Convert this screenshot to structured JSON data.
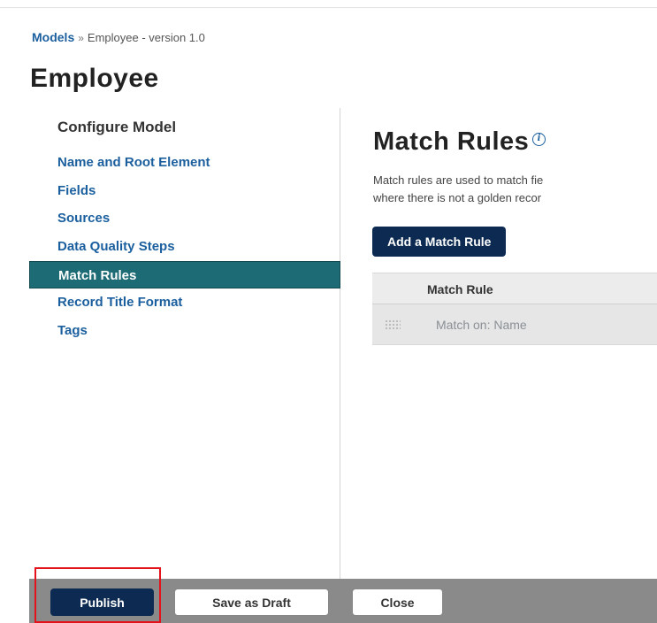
{
  "breadcrumb": {
    "root": "Models",
    "separator": "»",
    "current": "Employee - version 1.0"
  },
  "page_title": "Employee",
  "sidebar": {
    "heading": "Configure Model",
    "items": [
      {
        "label": "Name and Root Element",
        "active": false
      },
      {
        "label": "Fields",
        "active": false
      },
      {
        "label": "Sources",
        "active": false
      },
      {
        "label": "Data Quality Steps",
        "active": false
      },
      {
        "label": "Match Rules",
        "active": true
      },
      {
        "label": "Record Title Format",
        "active": false
      },
      {
        "label": "Tags",
        "active": false
      }
    ]
  },
  "main": {
    "title": "Match Rules",
    "info_icon": "info-icon",
    "description_line1": "Match rules are used to match fie",
    "description_line2": "where there is not a golden recor",
    "add_button_label": "Add a Match Rule",
    "table": {
      "header": "Match Rule",
      "rows": [
        {
          "label": "Match on: Name"
        }
      ]
    }
  },
  "footer": {
    "publish_label": "Publish",
    "save_draft_label": "Save as Draft",
    "close_label": "Close"
  },
  "colors": {
    "link_blue": "#1b5f9e",
    "active_teal": "#1d6b74",
    "primary_navy": "#0d2b52",
    "footer_gray": "#8a8a8a",
    "highlight_red": "#e3121b"
  }
}
